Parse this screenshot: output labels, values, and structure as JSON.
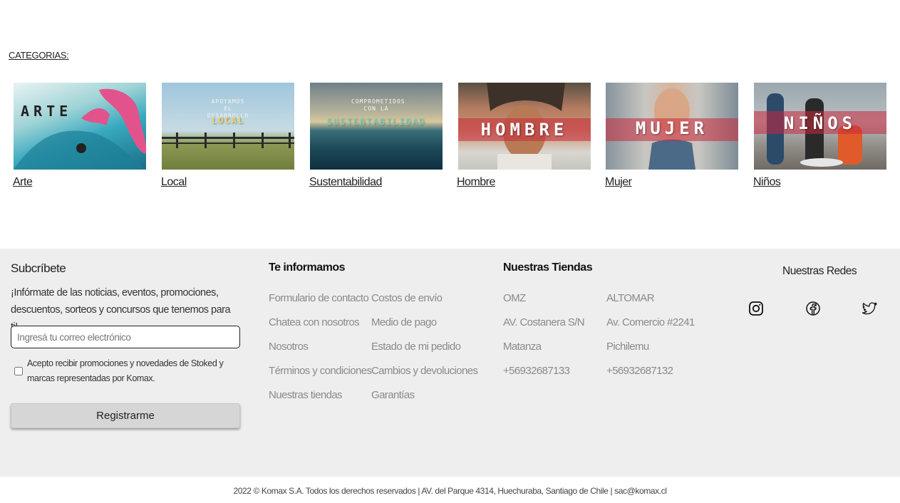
{
  "categories": {
    "title": "CATEGORIAS:",
    "items": [
      {
        "label": "Arte",
        "overlay": "ARTE",
        "overlay_small": ""
      },
      {
        "label": "Local",
        "overlay": "LOCAL",
        "overlay_small": "APOYAMOS EL DESARROLLO"
      },
      {
        "label": "Sustentabilidad",
        "overlay": "SUSTENTABILIDAD",
        "overlay_small": "COMPROMETIDOS CON LA"
      },
      {
        "label": "Hombre",
        "overlay": "HOMBRE",
        "overlay_small": ""
      },
      {
        "label": "Mujer",
        "overlay": "MUJER",
        "overlay_small": ""
      },
      {
        "label": "Niños",
        "overlay": "NIÑOS",
        "overlay_small": ""
      }
    ]
  },
  "subscribe": {
    "title": "Subcríbete",
    "text": "¡Infórmate de las noticias, eventos, promociones, descuentos, sorteos y concursos que tenemos para ti!",
    "email_placeholder": "Ingresá tu correo electrónico",
    "consent": "Acepto recibir promociones y novedades de Stoked y marcas representadas por Komax.",
    "button": "Registrarme"
  },
  "info": {
    "title": "Te informamos",
    "col1": [
      "Formulario de contacto",
      "Chatea con nosotros",
      "Nosotros",
      "Términos y condiciones",
      "Nuestras tiendas"
    ],
    "col2": [
      "Costos de envío",
      "Medio de pago",
      "Estado de mi pedido",
      "Cambios y devoluciones",
      "Garantías"
    ]
  },
  "stores": {
    "title": "Nuestras Tiendas",
    "store1": [
      "OMZ",
      "AV. Costanera S/N",
      "Matanza",
      "+56932687133"
    ],
    "store2": [
      "ALTOMAR",
      "Av. Comercio #2241",
      "Pichilemu",
      "+56932687132"
    ]
  },
  "social": {
    "title": "Nuestras Redes",
    "icons": [
      "instagram-icon",
      "facebook-icon",
      "twitter-icon"
    ]
  },
  "copyright": "2022 © Komax S.A. Todos los derechos reservados | AV. del Parque 4314, Huechuraba, Santiago de Chile | sac@komax.cl",
  "colors": {
    "footer_bg": "#eeeeee",
    "band": "#c8283c",
    "link": "#8a8a8a"
  }
}
